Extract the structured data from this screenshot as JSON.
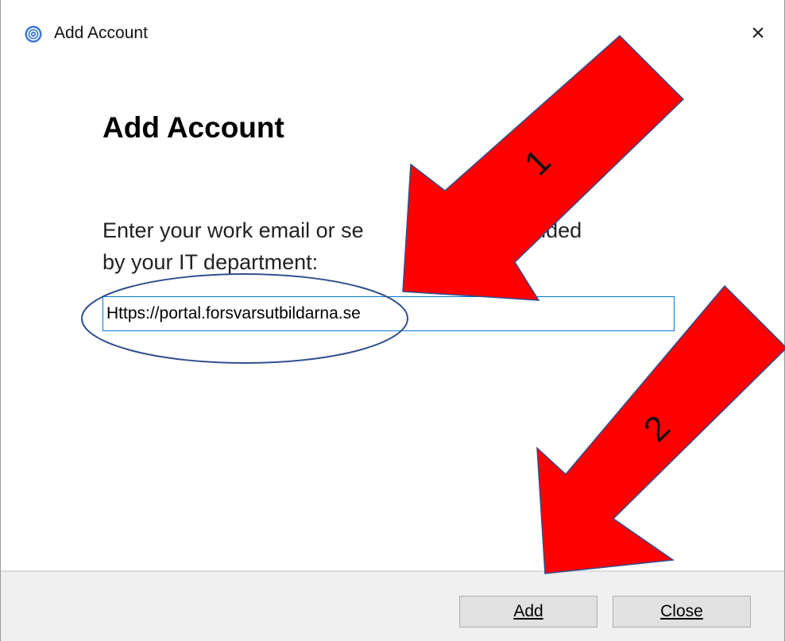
{
  "window": {
    "title": "Add Account",
    "close_glyph": "×",
    "app_icon": "app-swirl-icon"
  },
  "main": {
    "heading": "Add Account",
    "prompt": "Enter your work email or se          s provided by your IT department:",
    "prompt_line1": "Enter your work email or se",
    "prompt_line1_tail": "s provided",
    "prompt_line2": "by your IT department:",
    "url_value": "Https://portal.forsvarsutbildarna.se"
  },
  "footer": {
    "add_label": "Add",
    "close_label": "Close"
  },
  "annotations": {
    "arrow1_number": "1",
    "arrow2_number": "2",
    "arrow_color": "#ff0000",
    "ellipse_color": "#2f4f8f"
  },
  "colors": {
    "accent": "#0078d7",
    "footer_bg": "#f0f0f0",
    "button_bg": "#e1e1e1"
  }
}
